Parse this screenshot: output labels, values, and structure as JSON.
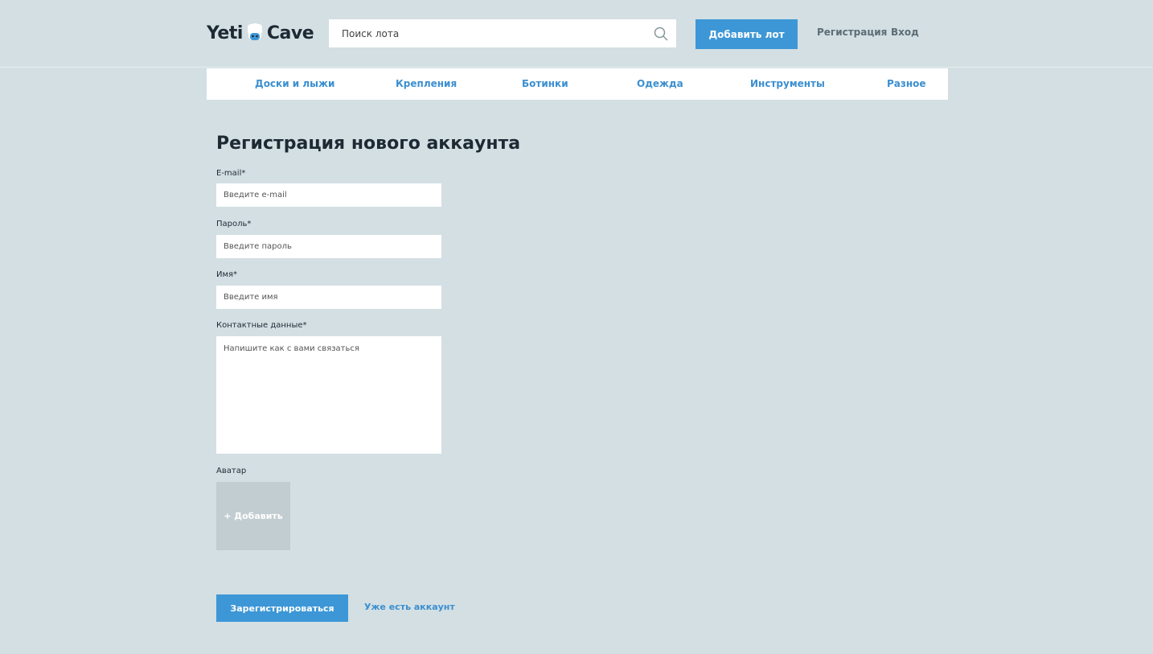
{
  "header": {
    "logo_left": "Yeti",
    "logo_right": "Cave",
    "search": {
      "placeholder": "Поиск лота"
    },
    "add_lot_label": "Добавить лот",
    "register_label": "Регистрация",
    "login_label": "Вход"
  },
  "categories": [
    {
      "label": "Доски и лыжи"
    },
    {
      "label": "Крепления"
    },
    {
      "label": "Ботинки"
    },
    {
      "label": "Одежда"
    },
    {
      "label": "Инструменты"
    },
    {
      "label": "Разное"
    }
  ],
  "form": {
    "title": "Регистрация нового аккаунта",
    "email": {
      "label": "E-mail*",
      "placeholder": "Введите e-mail"
    },
    "password": {
      "label": "Пароль*",
      "placeholder": "Введите пароль"
    },
    "name": {
      "label": "Имя*",
      "placeholder": "Введите имя"
    },
    "contacts": {
      "label": "Контактные данные*",
      "placeholder": "Напишите как с вами связаться"
    },
    "avatar": {
      "label": "Аватар",
      "add_label": "+ Добавить"
    },
    "submit_label": "Зарегистрироваться",
    "has_account_label": "Уже есть аккаунт"
  },
  "colors": {
    "background": "#d3dfe3",
    "accent": "#3d97d6",
    "link": "#3b8fd0",
    "text": "#1e2a33"
  }
}
